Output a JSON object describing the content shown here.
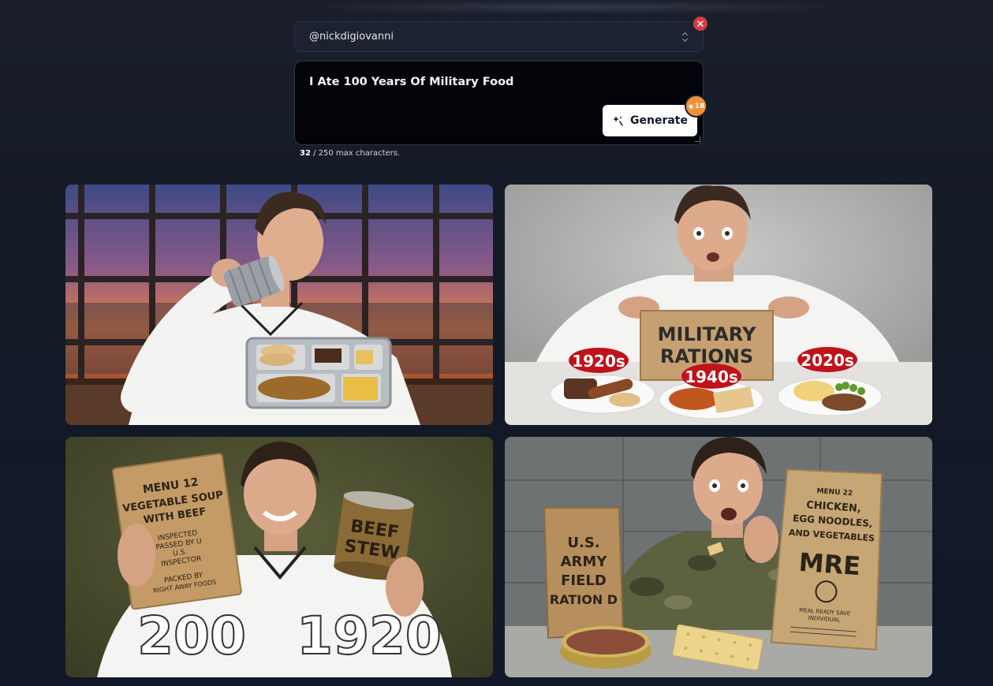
{
  "channel": {
    "value": "@nickdigiovanni"
  },
  "prompt": {
    "text": "I Ate 100 Years Of Military Food",
    "char_count": "32",
    "char_suffix": " / 250 max characters."
  },
  "generate": {
    "label": "Generate",
    "credits": "18"
  },
  "thumbnails": [
    {
      "texts": []
    },
    {
      "texts": [
        "MILITARY",
        "RATIONS",
        "1920s",
        "1940s",
        "2020s"
      ]
    },
    {
      "texts": [
        "MENU 12",
        "VEGETABLE SOUP",
        "WITH BEEF",
        "INSPECTED",
        "PASSED BY U",
        "U.S.",
        "INSPECTOR",
        "PACKED BY",
        "RIGHT AWAY FOODS",
        "BEEF",
        "STEW",
        "200",
        "1920"
      ]
    },
    {
      "texts": [
        "U.S.",
        "ARMY",
        "FIELD",
        "RATION D",
        "MENU 22",
        "CHICKEN,",
        "EGG NOODLES,",
        "AND VEGETABLES",
        "MRE",
        "MEAL READY SAVE",
        "INDIVIDUAL"
      ]
    }
  ],
  "colors": {
    "accent_orange": "#f0913a",
    "clear_red": "#d33b45",
    "ration_red": "#c0121a"
  }
}
